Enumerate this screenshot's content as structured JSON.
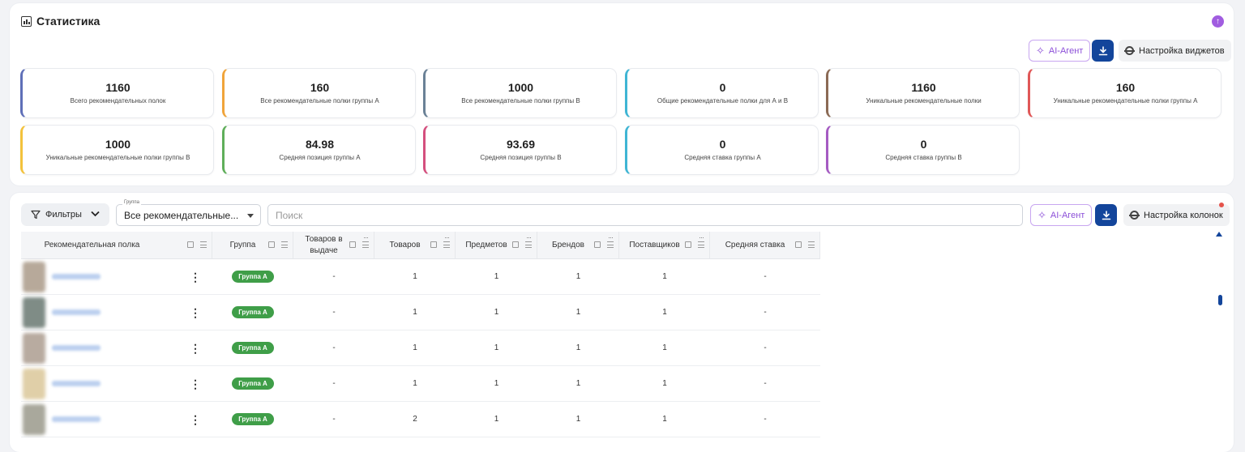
{
  "stats": {
    "title": "Статистика",
    "ai_label": "AI-Агент",
    "settings_label": "Настройка виджетов",
    "cards": [
      {
        "value": "1160",
        "label": "Всего рекомендательных полок",
        "color": "#5f6fb8"
      },
      {
        "value": "160",
        "label": "Все рекомендательные полки группы А",
        "color": "#f0a43a"
      },
      {
        "value": "1000",
        "label": "Все рекомендательные полки группы В",
        "color": "#6a8196"
      },
      {
        "value": "0",
        "label": "Общие рекомендательные полки для А и В",
        "color": "#3fb5d4"
      },
      {
        "value": "1160",
        "label": "Уникальные рекомендательные полки",
        "color": "#8b6a55"
      },
      {
        "value": "160",
        "label": "Уникальные рекомендательные полки группы А",
        "color": "#e05757"
      },
      {
        "value": "1000",
        "label": "Уникальные рекомендательные полки группы В",
        "color": "#f3c23c"
      },
      {
        "value": "84.98",
        "label": "Средняя позиция группы А",
        "color": "#5fae5a"
      },
      {
        "value": "93.69",
        "label": "Средняя позиция группы В",
        "color": "#d44f7e"
      },
      {
        "value": "0",
        "label": "Средняя ставка группы А",
        "color": "#3fb5d4"
      },
      {
        "value": "0",
        "label": "Средняя ставка группы В",
        "color": "#a55bc2"
      }
    ]
  },
  "table_toolbar": {
    "filters_label": "Фильтры",
    "group_legend": "Группа",
    "group_value": "Все рекомендательные...",
    "search_placeholder": "Поиск",
    "ai_label": "AI-Агент",
    "columns_settings_label": "Настройка колонок"
  },
  "table": {
    "columns": [
      {
        "label": "Рекомендательная полка"
      },
      {
        "label": "Группа"
      },
      {
        "label": "Товаров в выдаче"
      },
      {
        "label": "Товаров"
      },
      {
        "label": "Предметов"
      },
      {
        "label": "Брендов"
      },
      {
        "label": "Поставщиков"
      },
      {
        "label": "Средняя ставка"
      }
    ],
    "rows": [
      {
        "group": "Группа А",
        "in_results": "-",
        "products": "1",
        "subjects": "1",
        "brands": "1",
        "suppliers": "1",
        "avg_bid": "-"
      },
      {
        "group": "Группа А",
        "in_results": "-",
        "products": "1",
        "subjects": "1",
        "brands": "1",
        "suppliers": "1",
        "avg_bid": "-"
      },
      {
        "group": "Группа А",
        "in_results": "-",
        "products": "1",
        "subjects": "1",
        "brands": "1",
        "suppliers": "1",
        "avg_bid": "-"
      },
      {
        "group": "Группа А",
        "in_results": "-",
        "products": "1",
        "subjects": "1",
        "brands": "1",
        "suppliers": "1",
        "avg_bid": "-"
      },
      {
        "group": "Группа А",
        "in_results": "-",
        "products": "2",
        "subjects": "1",
        "brands": "1",
        "suppliers": "1",
        "avg_bid": "-"
      }
    ]
  },
  "colors": {
    "accent": "#13459b",
    "ai_purple": "#8c4fd8",
    "badge_green": "#3f9e48",
    "collapse_purple": "#a15de0"
  }
}
